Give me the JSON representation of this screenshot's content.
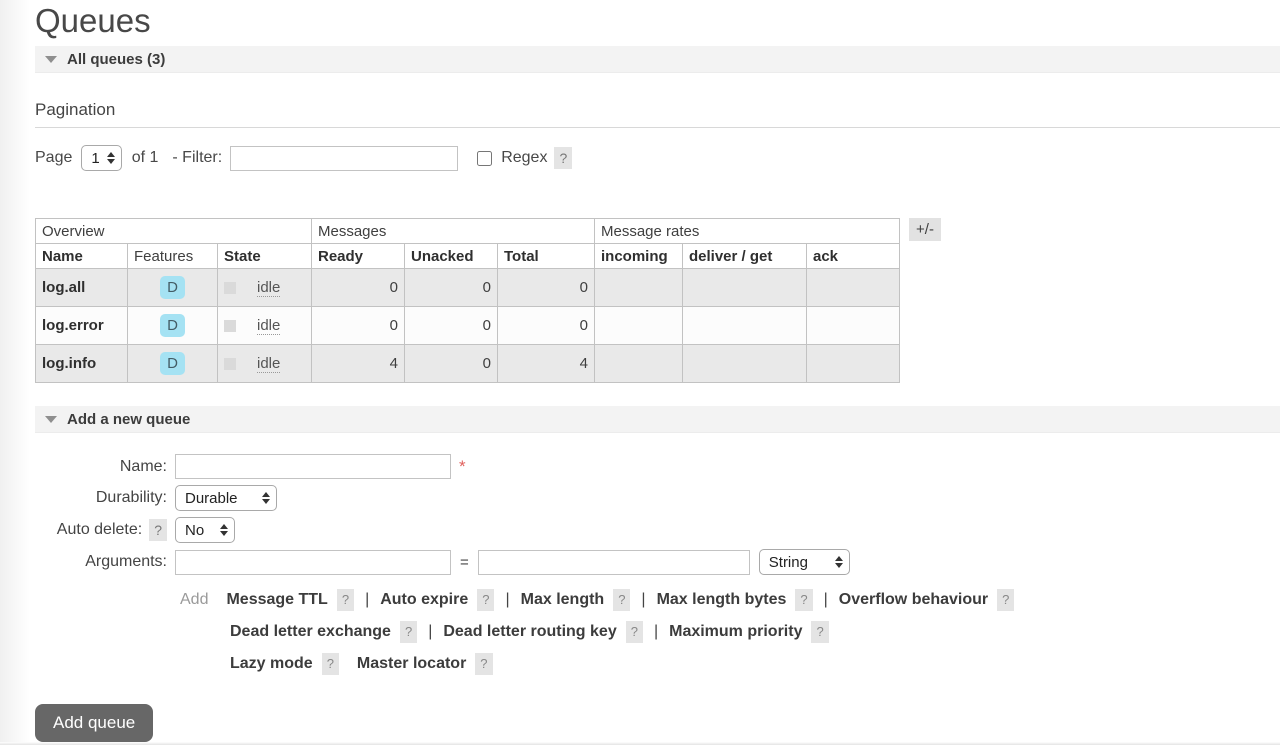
{
  "page": {
    "title": "Queues"
  },
  "sections": {
    "all_queues_label": "All queues (3)",
    "add_queue_label": "Add a new queue"
  },
  "ui": {
    "help": "?",
    "columns_button": "+/-"
  },
  "pagination": {
    "heading": "Pagination",
    "page_label": "Page",
    "page_value": "1",
    "of_label": "of 1",
    "filter_label": "- Filter:",
    "filter_value": "",
    "regex_label": "Regex"
  },
  "table": {
    "groups": {
      "overview": "Overview",
      "messages": "Messages",
      "message_rates": "Message rates"
    },
    "headers": {
      "name": "Name",
      "features": "Features",
      "state": "State",
      "ready": "Ready",
      "unacked": "Unacked",
      "total": "Total",
      "incoming": "incoming",
      "deliver_get": "deliver / get",
      "ack": "ack"
    },
    "rows": [
      {
        "name": "log.all",
        "features": "D",
        "state": "idle",
        "ready": "0",
        "unacked": "0",
        "total": "0",
        "incoming": "",
        "deliver_get": "",
        "ack": ""
      },
      {
        "name": "log.error",
        "features": "D",
        "state": "idle",
        "ready": "0",
        "unacked": "0",
        "total": "0",
        "incoming": "",
        "deliver_get": "",
        "ack": ""
      },
      {
        "name": "log.info",
        "features": "D",
        "state": "idle",
        "ready": "4",
        "unacked": "0",
        "total": "4",
        "incoming": "",
        "deliver_get": "",
        "ack": ""
      }
    ]
  },
  "form": {
    "name_label": "Name:",
    "name_value": "",
    "required_marker": "*",
    "durability_label": "Durability:",
    "durability_value": "Durable",
    "auto_delete_label": "Auto delete:",
    "auto_delete_value": "No",
    "arguments_label": "Arguments:",
    "argument_key_value": "",
    "equals": "=",
    "argument_value_value": "",
    "type_value": "String",
    "add_label": "Add",
    "links_line1": [
      {
        "label": "Message TTL"
      },
      {
        "label": "Auto expire"
      },
      {
        "label": "Max length"
      },
      {
        "label": "Max length bytes"
      },
      {
        "label": "Overflow behaviour"
      }
    ],
    "links_line2": [
      {
        "label": "Dead letter exchange"
      },
      {
        "label": "Dead letter routing key"
      },
      {
        "label": "Maximum priority"
      }
    ],
    "links_line3": [
      {
        "label": "Lazy mode"
      },
      {
        "label": "Master locator"
      }
    ]
  },
  "buttons": {
    "add_queue": "Add queue"
  },
  "colors": {
    "durable_badge": "#a5e2f3",
    "button": "#676767",
    "required": "#e0605c",
    "row_odd": "#e9e9e9"
  }
}
